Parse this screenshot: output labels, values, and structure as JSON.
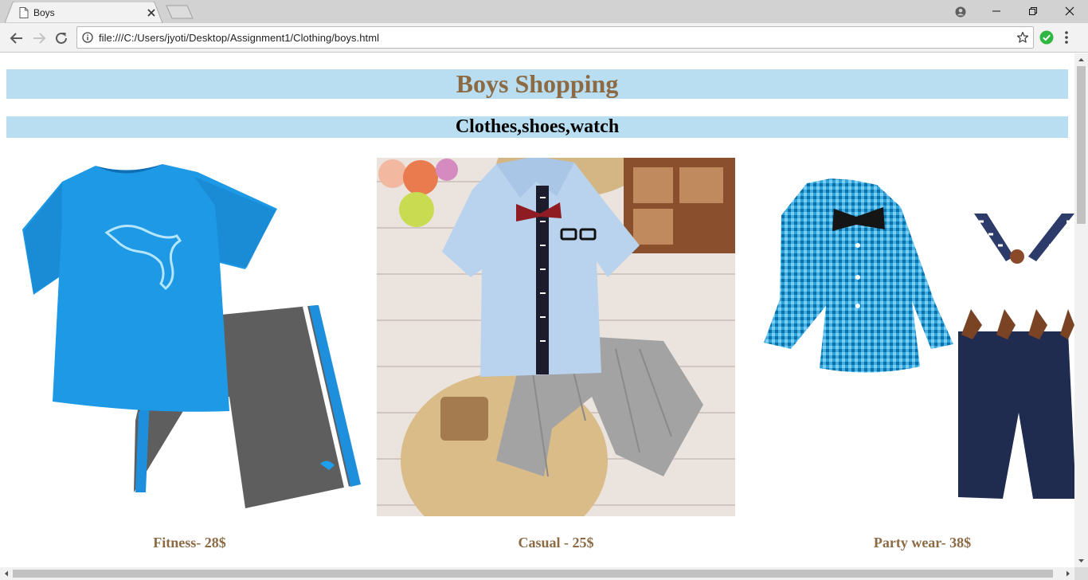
{
  "browser": {
    "tab_title": "Boys",
    "url": "file:///C:/Users/jyoti/Desktop/Assignment1/Clothing/boys.html"
  },
  "page": {
    "title": "Boys Shopping",
    "subtitle": "Clothes,shoes,watch",
    "products": [
      {
        "caption": "Fitness- 28$",
        "image": "boys-fitness-outfit-tshirt-shorts"
      },
      {
        "caption": "Casual - 25$",
        "image": "boys-casual-shirt-bowtie-striped-shorts"
      },
      {
        "caption": "Party wear- 38$",
        "image": "boys-party-wear-gingham-shirt-suspenders"
      }
    ]
  },
  "colors": {
    "heading_bg": "#b9def1",
    "heading_text": "#8b6a44",
    "caption_text": "#8b6a44"
  }
}
